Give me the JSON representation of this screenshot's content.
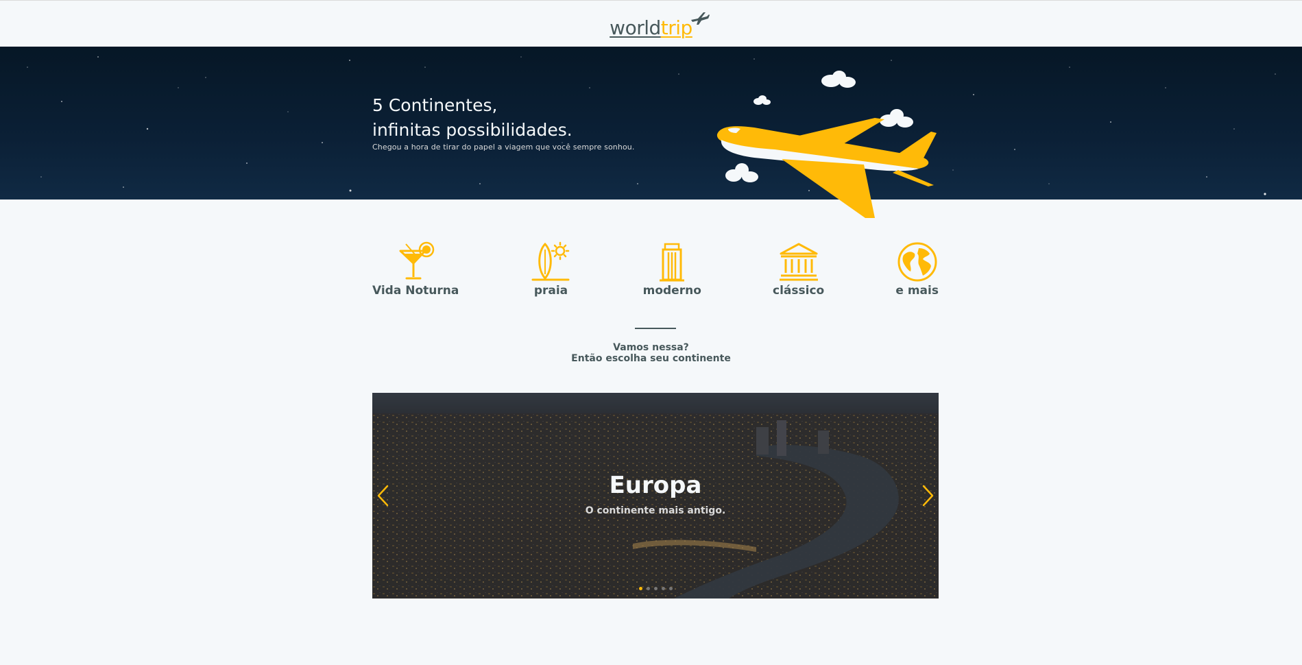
{
  "header": {
    "logo_world": "world",
    "logo_trip": "trip"
  },
  "banner": {
    "title_line1": "5 Continentes,",
    "title_line2": "infinitas possibilidades.",
    "subtitle": "Chegou a hora de tirar do papel a viagem que você sempre sonhou."
  },
  "travel_types": [
    {
      "label": "Vida Noturna",
      "icon": "cocktail-icon"
    },
    {
      "label": "praia",
      "icon": "surfboard-icon"
    },
    {
      "label": "moderno",
      "icon": "building-icon"
    },
    {
      "label": "clássico",
      "icon": "museum-icon"
    },
    {
      "label": "e mais",
      "icon": "earth-icon"
    }
  ],
  "invite": {
    "line1": "Vamos nessa?",
    "line2": "Então escolha seu continente"
  },
  "carousel": {
    "slides_count": 5,
    "active_index": 0,
    "active_slide": {
      "title": "Europa",
      "subtitle": "O continente mais antigo."
    }
  },
  "colors": {
    "accent": "#FFBA08",
    "text_dark": "#47585B",
    "background": "#F5F8FA",
    "banner_dark": "#0B2036"
  }
}
